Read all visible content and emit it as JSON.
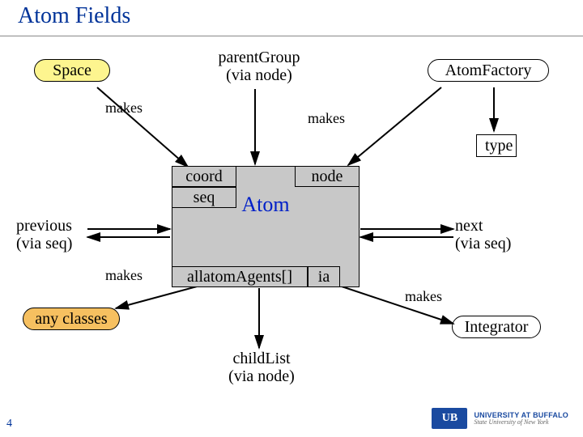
{
  "title": "Atom Fields",
  "nodes": {
    "space": "Space",
    "atom_factory": "AtomFactory",
    "parent_group": "parentGroup\n(via node)",
    "type": "type",
    "coord": "coord",
    "seq": "seq",
    "node_field": "node",
    "atom": "Atom",
    "allatom_agents": "allatomAgents[]",
    "ia": "ia",
    "any_classes": "any classes",
    "integrator": "Integrator",
    "previous": "previous\n(via seq)",
    "next": "next\n(via seq)",
    "child_list": "childList\n(via node)"
  },
  "edges": {
    "makes": "makes"
  },
  "footer": {
    "page_number": "4",
    "uni_name": "UNIVERSITY AT BUFFALO",
    "uni_sub": "State University of New York",
    "logo_text": "UB"
  }
}
